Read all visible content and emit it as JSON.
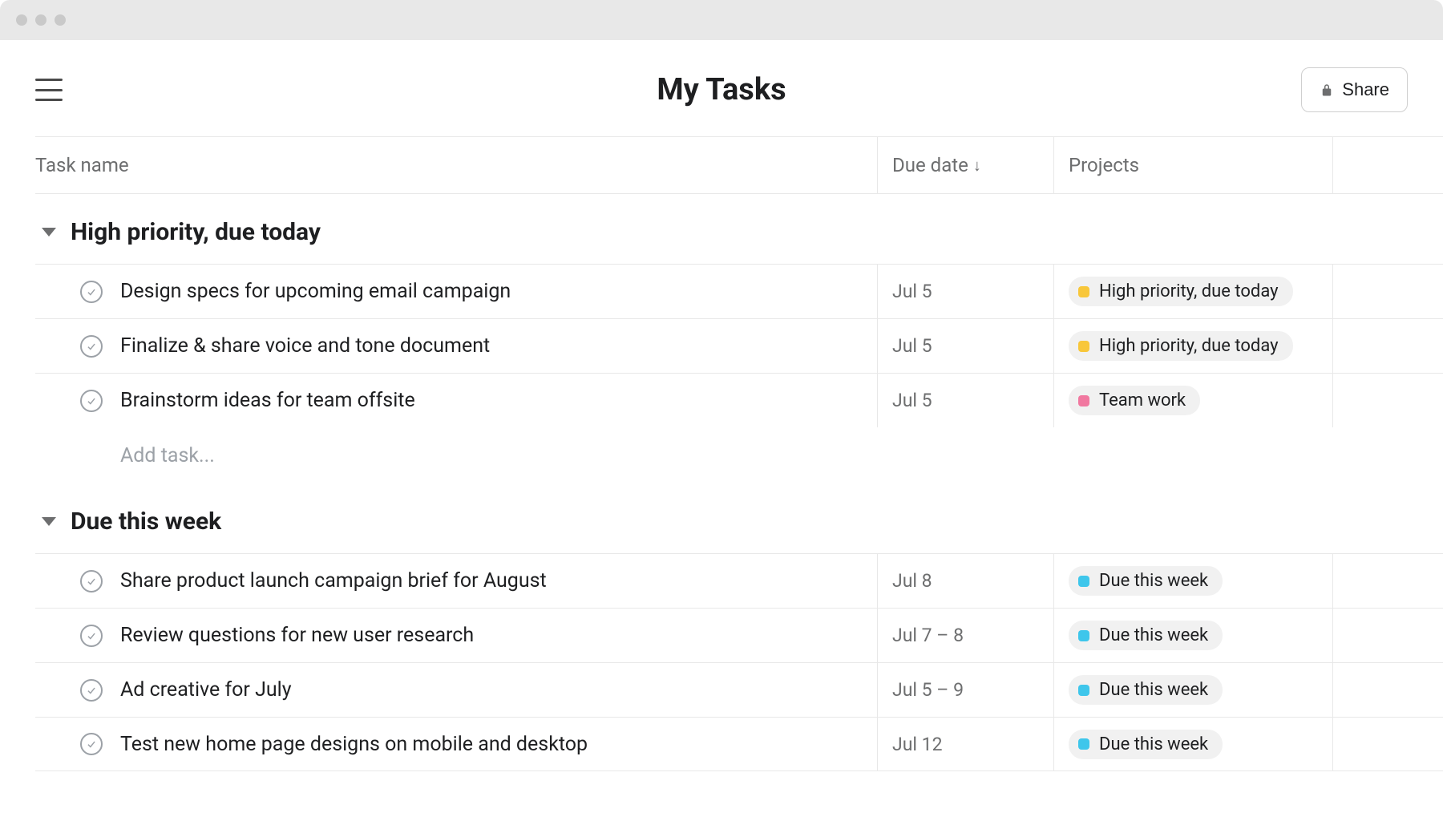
{
  "header": {
    "title": "My Tasks",
    "share_label": "Share"
  },
  "columns": {
    "name": "Task name",
    "due": "Due date",
    "projects": "Projects",
    "sort_indicator": "↓"
  },
  "project_colors": {
    "high_priority": "yellow",
    "team_work": "pink",
    "due_this_week": "cyan"
  },
  "sections": [
    {
      "title": "High priority, due today",
      "add_task_placeholder": "Add task...",
      "tasks": [
        {
          "name": "Design specs for upcoming email campaign",
          "due": "Jul 5",
          "project": "High priority, due today",
          "project_color": "yellow"
        },
        {
          "name": "Finalize & share voice and tone document",
          "due": "Jul 5",
          "project": "High priority, due today",
          "project_color": "yellow"
        },
        {
          "name": "Brainstorm ideas for team offsite",
          "due": "Jul 5",
          "project": "Team work",
          "project_color": "pink"
        }
      ]
    },
    {
      "title": "Due this week",
      "tasks": [
        {
          "name": "Share product launch campaign brief for August",
          "due": "Jul 8",
          "project": "Due this week",
          "project_color": "cyan"
        },
        {
          "name": "Review questions for new user research",
          "due": "Jul 7 – 8",
          "project": "Due this week",
          "project_color": "cyan"
        },
        {
          "name": "Ad creative for July",
          "due": "Jul 5 – 9",
          "project": "Due this week",
          "project_color": "cyan"
        },
        {
          "name": "Test new home page designs on mobile and desktop",
          "due": "Jul 12",
          "project": "Due this week",
          "project_color": "cyan"
        }
      ]
    }
  ]
}
